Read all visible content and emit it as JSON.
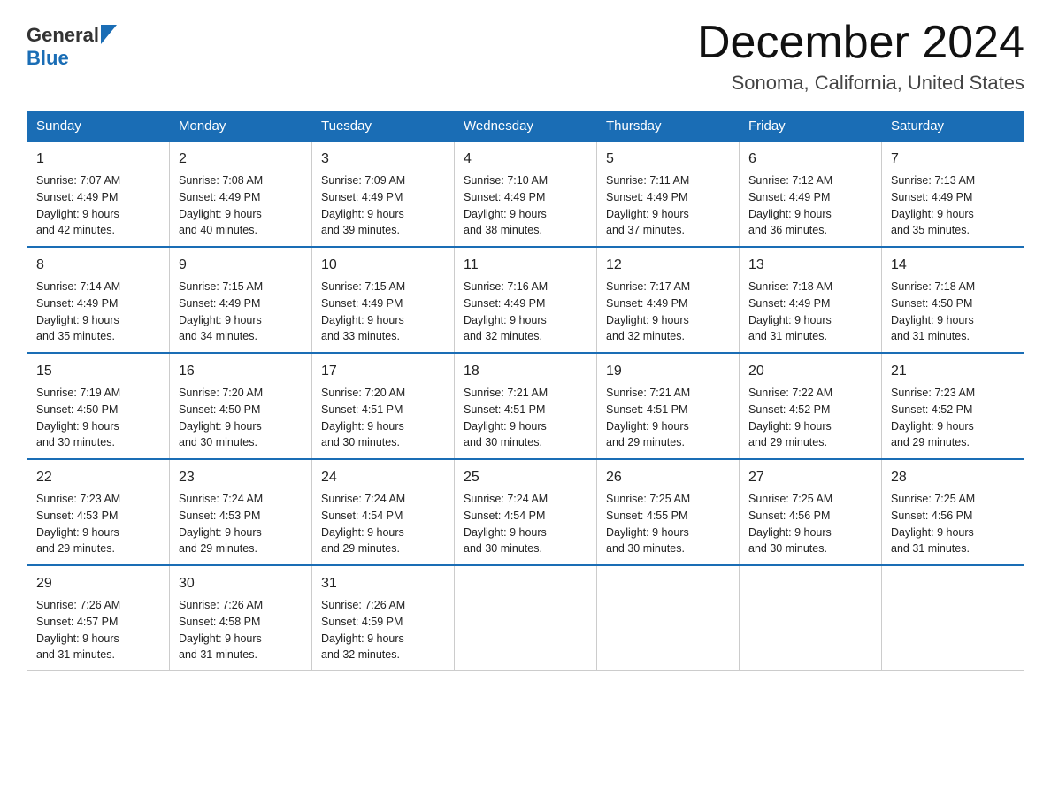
{
  "header": {
    "logo": {
      "general": "General",
      "blue": "Blue"
    },
    "title": "December 2024",
    "location": "Sonoma, California, United States"
  },
  "days_of_week": [
    "Sunday",
    "Monday",
    "Tuesday",
    "Wednesday",
    "Thursday",
    "Friday",
    "Saturday"
  ],
  "weeks": [
    [
      {
        "day": 1,
        "sunrise": "7:07 AM",
        "sunset": "4:49 PM",
        "daylight": "9 hours and 42 minutes."
      },
      {
        "day": 2,
        "sunrise": "7:08 AM",
        "sunset": "4:49 PM",
        "daylight": "9 hours and 40 minutes."
      },
      {
        "day": 3,
        "sunrise": "7:09 AM",
        "sunset": "4:49 PM",
        "daylight": "9 hours and 39 minutes."
      },
      {
        "day": 4,
        "sunrise": "7:10 AM",
        "sunset": "4:49 PM",
        "daylight": "9 hours and 38 minutes."
      },
      {
        "day": 5,
        "sunrise": "7:11 AM",
        "sunset": "4:49 PM",
        "daylight": "9 hours and 37 minutes."
      },
      {
        "day": 6,
        "sunrise": "7:12 AM",
        "sunset": "4:49 PM",
        "daylight": "9 hours and 36 minutes."
      },
      {
        "day": 7,
        "sunrise": "7:13 AM",
        "sunset": "4:49 PM",
        "daylight": "9 hours and 35 minutes."
      }
    ],
    [
      {
        "day": 8,
        "sunrise": "7:14 AM",
        "sunset": "4:49 PM",
        "daylight": "9 hours and 35 minutes."
      },
      {
        "day": 9,
        "sunrise": "7:15 AM",
        "sunset": "4:49 PM",
        "daylight": "9 hours and 34 minutes."
      },
      {
        "day": 10,
        "sunrise": "7:15 AM",
        "sunset": "4:49 PM",
        "daylight": "9 hours and 33 minutes."
      },
      {
        "day": 11,
        "sunrise": "7:16 AM",
        "sunset": "4:49 PM",
        "daylight": "9 hours and 32 minutes."
      },
      {
        "day": 12,
        "sunrise": "7:17 AM",
        "sunset": "4:49 PM",
        "daylight": "9 hours and 32 minutes."
      },
      {
        "day": 13,
        "sunrise": "7:18 AM",
        "sunset": "4:49 PM",
        "daylight": "9 hours and 31 minutes."
      },
      {
        "day": 14,
        "sunrise": "7:18 AM",
        "sunset": "4:50 PM",
        "daylight": "9 hours and 31 minutes."
      }
    ],
    [
      {
        "day": 15,
        "sunrise": "7:19 AM",
        "sunset": "4:50 PM",
        "daylight": "9 hours and 30 minutes."
      },
      {
        "day": 16,
        "sunrise": "7:20 AM",
        "sunset": "4:50 PM",
        "daylight": "9 hours and 30 minutes."
      },
      {
        "day": 17,
        "sunrise": "7:20 AM",
        "sunset": "4:51 PM",
        "daylight": "9 hours and 30 minutes."
      },
      {
        "day": 18,
        "sunrise": "7:21 AM",
        "sunset": "4:51 PM",
        "daylight": "9 hours and 30 minutes."
      },
      {
        "day": 19,
        "sunrise": "7:21 AM",
        "sunset": "4:51 PM",
        "daylight": "9 hours and 29 minutes."
      },
      {
        "day": 20,
        "sunrise": "7:22 AM",
        "sunset": "4:52 PM",
        "daylight": "9 hours and 29 minutes."
      },
      {
        "day": 21,
        "sunrise": "7:23 AM",
        "sunset": "4:52 PM",
        "daylight": "9 hours and 29 minutes."
      }
    ],
    [
      {
        "day": 22,
        "sunrise": "7:23 AM",
        "sunset": "4:53 PM",
        "daylight": "9 hours and 29 minutes."
      },
      {
        "day": 23,
        "sunrise": "7:24 AM",
        "sunset": "4:53 PM",
        "daylight": "9 hours and 29 minutes."
      },
      {
        "day": 24,
        "sunrise": "7:24 AM",
        "sunset": "4:54 PM",
        "daylight": "9 hours and 29 minutes."
      },
      {
        "day": 25,
        "sunrise": "7:24 AM",
        "sunset": "4:54 PM",
        "daylight": "9 hours and 30 minutes."
      },
      {
        "day": 26,
        "sunrise": "7:25 AM",
        "sunset": "4:55 PM",
        "daylight": "9 hours and 30 minutes."
      },
      {
        "day": 27,
        "sunrise": "7:25 AM",
        "sunset": "4:56 PM",
        "daylight": "9 hours and 30 minutes."
      },
      {
        "day": 28,
        "sunrise": "7:25 AM",
        "sunset": "4:56 PM",
        "daylight": "9 hours and 31 minutes."
      }
    ],
    [
      {
        "day": 29,
        "sunrise": "7:26 AM",
        "sunset": "4:57 PM",
        "daylight": "9 hours and 31 minutes."
      },
      {
        "day": 30,
        "sunrise": "7:26 AM",
        "sunset": "4:58 PM",
        "daylight": "9 hours and 31 minutes."
      },
      {
        "day": 31,
        "sunrise": "7:26 AM",
        "sunset": "4:59 PM",
        "daylight": "9 hours and 32 minutes."
      },
      null,
      null,
      null,
      null
    ]
  ],
  "labels": {
    "sunrise": "Sunrise:",
    "sunset": "Sunset:",
    "daylight": "Daylight:"
  }
}
